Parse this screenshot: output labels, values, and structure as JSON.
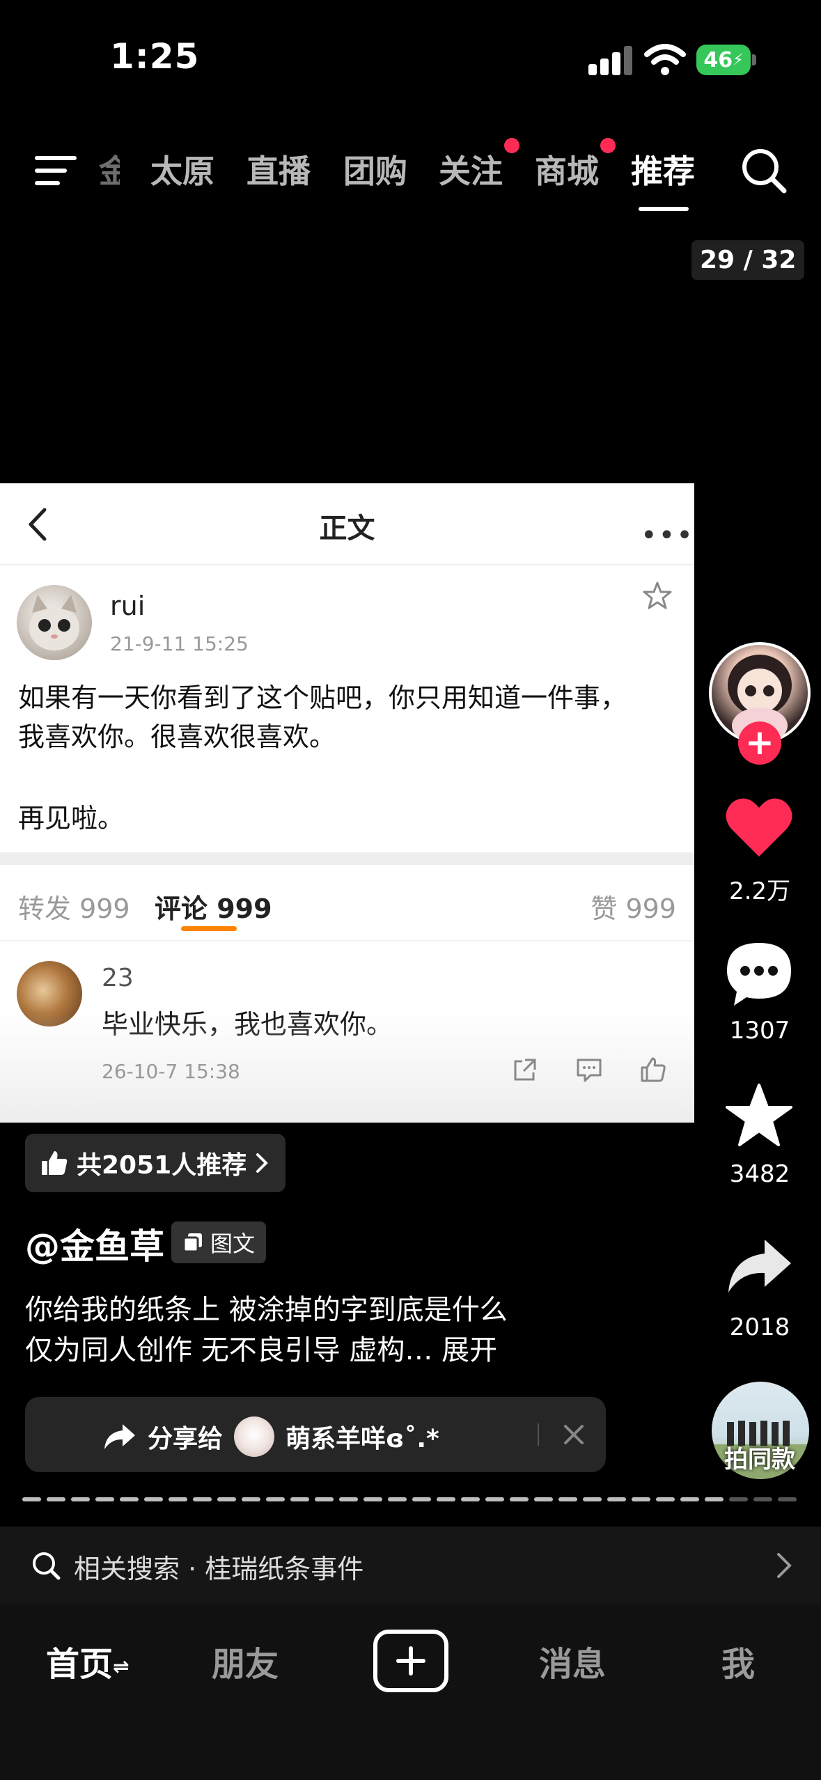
{
  "status_bar": {
    "time": "1:25",
    "battery": "46"
  },
  "top_nav": {
    "partial_item": "金",
    "items": [
      "太原",
      "直播",
      "团购",
      "关注",
      "商城",
      "推荐"
    ],
    "active": "推荐",
    "dots_on": [
      "关注",
      "商城"
    ],
    "page_counter": "29 / 32"
  },
  "post_card": {
    "header_title": "正文",
    "user_name": "rui",
    "post_time": "21-9-11 15:25",
    "text_line1": "如果有一天你看到了这个贴吧，你只用知道一件事，",
    "text_line2": "我喜欢你。很喜欢很喜欢。",
    "text_line3": "再见啦。",
    "tab_forward": "转发 999",
    "tab_comment": "评论 999",
    "tab_like": "赞 999",
    "comment": {
      "user": "23",
      "text": "毕业快乐，我也喜欢你。",
      "time": "26-10-7 15:38"
    }
  },
  "right_rail": {
    "like_count": "2.2万",
    "comment_count": "1307",
    "favorite_count": "3482",
    "share_count": "2018",
    "remix_label": "拍同款",
    "accent": "#fe2c55"
  },
  "description": {
    "recommend": "共2051人推荐",
    "author": "@金鱼草",
    "type_badge": "图文",
    "line1": "你给我的纸条上 被涂掉的字到底是什么",
    "line2": "仅为同人创作 无不良引导 虚构…  展开"
  },
  "share_bar": {
    "label": "分享给",
    "friend": "萌系羊咩ɞ˚.*"
  },
  "progress": {
    "total": 32,
    "current": 29
  },
  "related_search": {
    "text": "相关搜索 · 桂瑞纸条事件"
  },
  "tab_bar": {
    "home": "首页",
    "friends": "朋友",
    "messages": "消息",
    "me": "我"
  }
}
